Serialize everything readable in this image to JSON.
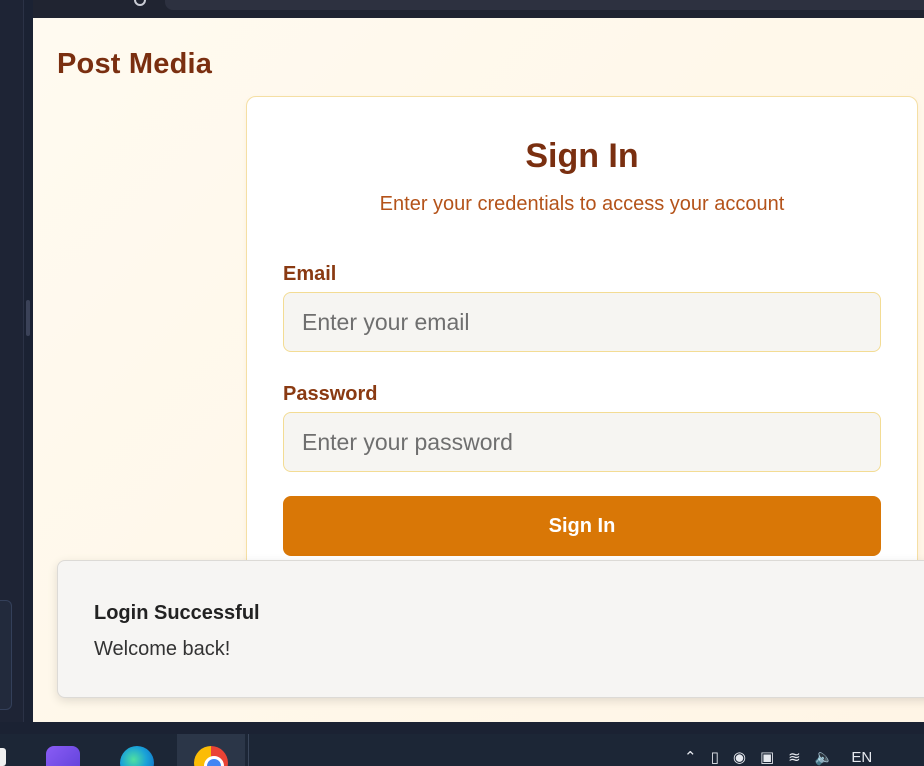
{
  "app": {
    "brand": "Post Media"
  },
  "signin": {
    "title": "Sign In",
    "subtitle": "Enter your credentials to access your account",
    "email_label": "Email",
    "email_placeholder": "Enter your email",
    "email_value": "",
    "password_label": "Password",
    "password_placeholder": "Enter your password",
    "password_value": "",
    "submit_label": "Sign In"
  },
  "toast": {
    "title": "Login Successful",
    "description": "Welcome back!"
  },
  "taskbar": {
    "apps": [
      "copilot-icon",
      "edge-icon",
      "chrome-icon"
    ],
    "tray_icons": [
      "chevron-up-icon",
      "battery-icon",
      "defender-icon",
      "display-icon",
      "wifi-icon",
      "volume-icon"
    ],
    "language": "EN"
  },
  "colors": {
    "brand": "#7a2f10",
    "accent": "#d97706",
    "subtitle": "#b4531a",
    "input_border": "#f3dc94"
  }
}
